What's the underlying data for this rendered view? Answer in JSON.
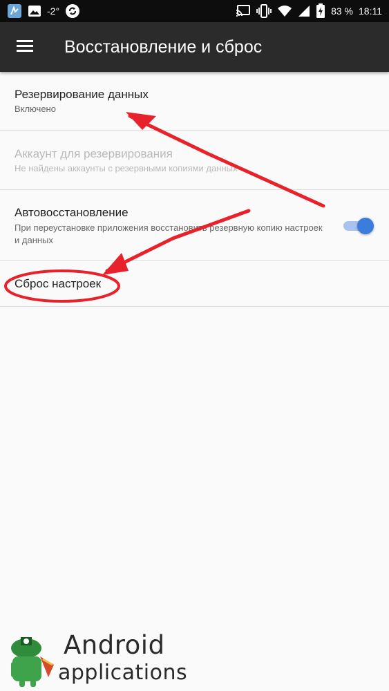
{
  "status_bar": {
    "icons_left": [
      "app-icon",
      "image-icon"
    ],
    "temperature": "-2°",
    "icons_right": [
      "cast-icon",
      "vibrate-icon",
      "wifi-icon",
      "signal-icon",
      "battery-charging-icon"
    ],
    "battery": "83 %",
    "time": "18:11"
  },
  "toolbar": {
    "menu_icon": "hamburger-menu-icon",
    "title": "Восстановление и сброс"
  },
  "items": [
    {
      "title": "Резервирование данных",
      "subtitle": "Включено",
      "enabled": true
    },
    {
      "title": "Аккаунт для резервирования",
      "subtitle": "Не найдены аккаунты с резервными копиями данных",
      "enabled": false
    },
    {
      "title": "Автовосстановление",
      "subtitle": "При переустановке приложения восстановить резервную копию настроек и данных",
      "enabled": true,
      "toggle": "on"
    },
    {
      "title": "Сброс настроек",
      "enabled": true
    }
  ],
  "annotations": {
    "arrow_color": "#e8222a",
    "ellipse_color": "#e8222a"
  },
  "colors": {
    "toolbar": "#2b2b2b",
    "toggle_accent": "#3b7ddd",
    "background": "#fafafa"
  },
  "watermark": {
    "line1": "Android",
    "line2": "applications",
    "logo": "android-pirate-logo"
  }
}
